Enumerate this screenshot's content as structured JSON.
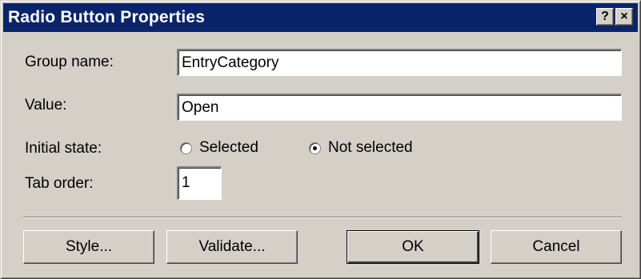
{
  "dialog": {
    "title": "Radio Button Properties",
    "help_button": "?",
    "close_button": "×"
  },
  "form": {
    "group_name_label": "Group name:",
    "group_name_value": "EntryCategory",
    "value_label": "Value:",
    "value_value": "Open",
    "initial_state_label": "Initial state:",
    "initial_state_options": [
      {
        "label": "Selected",
        "checked": false
      },
      {
        "label": "Not selected",
        "checked": true
      }
    ],
    "tab_order_label": "Tab order:",
    "tab_order_value": "1"
  },
  "buttons": {
    "style": "Style...",
    "validate": "Validate...",
    "ok": "OK",
    "cancel": "Cancel"
  },
  "colors": {
    "titlebar": "#0a246a",
    "dialog_face": "#d4d0c8"
  }
}
